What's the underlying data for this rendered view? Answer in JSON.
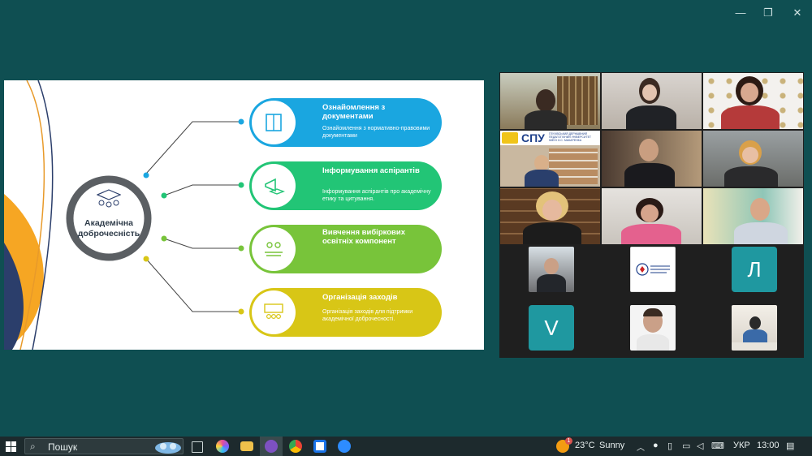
{
  "window": {
    "minimize": "—",
    "restore": "❐",
    "close": "✕"
  },
  "slide": {
    "hub_title": "Академічна доброчесність",
    "cards": [
      {
        "title": "Ознайомлення з документами",
        "desc": "Ознайомлення з нормативно-правовими документами",
        "color": "#1aa6e0"
      },
      {
        "title": "Інформування аспірантів",
        "desc": "Інформування аспірантів про академічну етику та цитування.",
        "color": "#22c576"
      },
      {
        "title": "Вивчення вибіркових освітніх компонент",
        "desc": "",
        "color": "#78c43a"
      },
      {
        "title": "Організація заходів",
        "desc": "Організація заходів для підтримки академічної доброчесності.",
        "color": "#d8c616"
      }
    ]
  },
  "gallery": {
    "banner_logo": "СПУ",
    "banner_text": "ГЛУХІВСЬКИЙ ДЕРЖАВНИЙ ПЕДАГОГІЧНИЙ УНІВЕРСИТЕТ ІМЕНІ О.С. МАКАРЕНКА",
    "letters": [
      "Л",
      "V"
    ],
    "letter_color": "#1f98a0"
  },
  "taskbar": {
    "search_placeholder": "Пошук",
    "weather_temp": "23°C",
    "weather_desc": "Sunny",
    "weather_badge": "1",
    "language": "УКР",
    "clock": "13:00"
  }
}
